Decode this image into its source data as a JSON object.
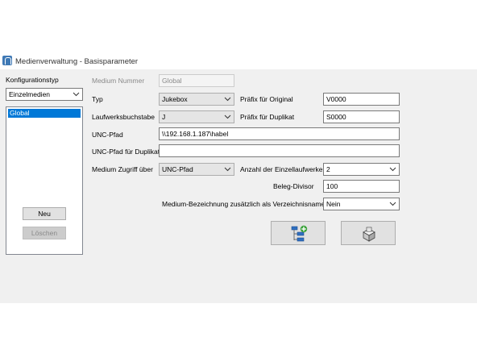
{
  "window": {
    "title": "Medienverwaltung - Basisparameter"
  },
  "left": {
    "group_label": "Konfigurationstyp",
    "type_combo": "Einzelmedien",
    "list_items": [
      "Global"
    ],
    "new_button": "Neu",
    "delete_button": "Löschen"
  },
  "form": {
    "medium_nummer": {
      "label": "Medium Nummer",
      "value": "Global"
    },
    "typ": {
      "label": "Typ",
      "value": "Jukebox"
    },
    "laufwerksbuchstabe": {
      "label": "Laufwerksbuchstabe",
      "value": "J"
    },
    "praefix_original": {
      "label": "Präfix für Original",
      "value": "V0000"
    },
    "praefix_duplikat": {
      "label": "Präfix für Duplikat",
      "value": "S0000"
    },
    "unc_pfad": {
      "label": "UNC-Pfad",
      "value": "\\\\192.168.1.187\\habel"
    },
    "unc_pfad_duplikat": {
      "label": "UNC-Pfad für Duplikat",
      "value": ""
    },
    "medium_zugriff": {
      "label": "Medium Zugriff über",
      "value": "UNC-Pfad"
    },
    "anzahl_einzellaufwerke": {
      "label": "Anzahl der Einzellaufwerke",
      "value": "2"
    },
    "beleg_divisor": {
      "label": "Beleg-Divisor",
      "value": "100"
    },
    "medium_bezeichnung": {
      "label": "Medium-Bezeichnung zusätzlich als Verzeichnisname",
      "value": "Nein"
    }
  },
  "actions": [
    {
      "icon": "add-tree-structure-icon"
    },
    {
      "icon": "archive-box-icon"
    }
  ]
}
